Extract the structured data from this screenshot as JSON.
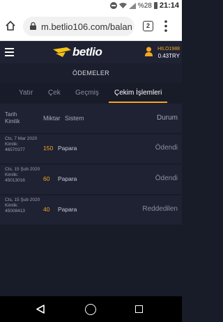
{
  "status_bar": {
    "battery_text": "%28",
    "time": "21:14"
  },
  "browser": {
    "url": "m.betlio106.com/balan",
    "tab_count": "2"
  },
  "header": {
    "logo_text": "betlio",
    "username": "HILO1988",
    "balance": "0.43TRY"
  },
  "page": {
    "title": "ÖDEMELER"
  },
  "tabs": [
    {
      "label": "Yatır"
    },
    {
      "label": "Çek"
    },
    {
      "label": "Geçmiş"
    },
    {
      "label": "Çekim İşlemleri"
    }
  ],
  "table": {
    "headers": {
      "date": "Tarih",
      "id": "Kimlik",
      "amount": "Miktar",
      "system": "Sistem",
      "status": "Durum"
    },
    "rows": [
      {
        "date": "Cts, 7 Mar 2020",
        "id_label": "Kimlik:",
        "id": "46570377",
        "amount": "150",
        "system": "Papara",
        "status": "Ödendi"
      },
      {
        "date": "Cts, 15 Şub 2020",
        "id_label": "Kimlik:",
        "id": "45013016",
        "amount": "60",
        "system": "Papara",
        "status": "Ödendi"
      },
      {
        "date": "Cts, 15 Şub 2020",
        "id_label": "Kimlik:",
        "id": "45008413",
        "amount": "40",
        "system": "Papara",
        "status": "Reddedilen"
      }
    ]
  },
  "colors": {
    "accent": "#f6a623",
    "background": "#181b28",
    "panel": "#1f2233"
  }
}
